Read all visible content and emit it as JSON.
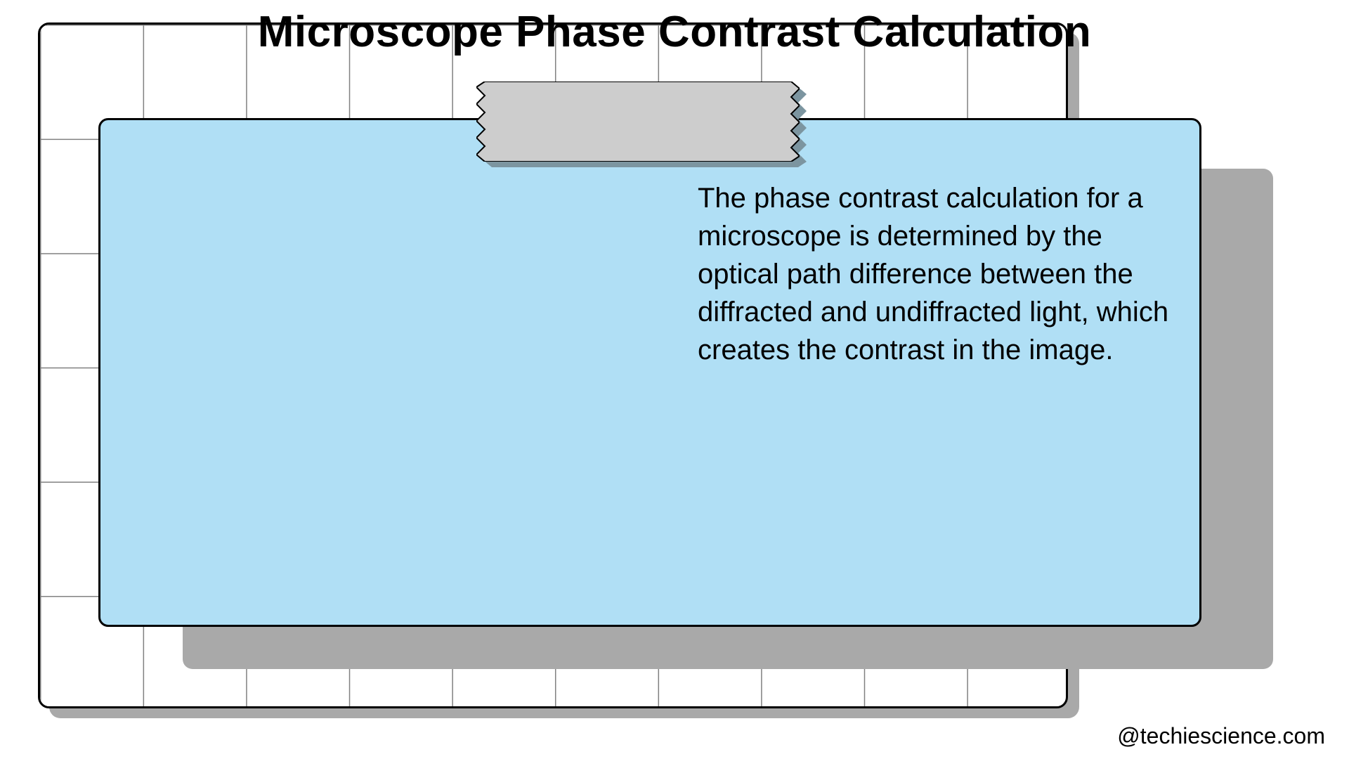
{
  "title": "Microscope Phase Contrast Calculation",
  "card": {
    "body": "The phase contrast calculation for a microscope is determined by the optical path difference between the diffracted and undiffracted light, which creates the contrast in the image."
  },
  "footer": "@techiescience.com",
  "colors": {
    "card_bg": "#b0dff5",
    "tape_fill": "#cdcdcd",
    "shadow": "#a9a9a9"
  }
}
